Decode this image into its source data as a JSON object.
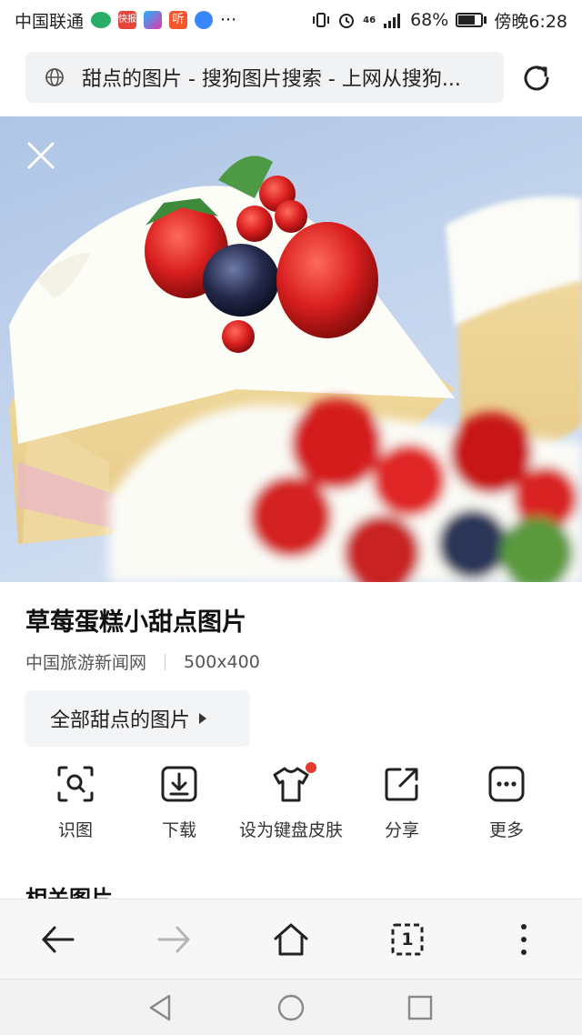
{
  "status_bar": {
    "carrier": "中国联通",
    "app_badge_kuaibao": "快报",
    "app_badge_ting": "听",
    "more": "···",
    "network": "46",
    "battery_percent": "68%",
    "battery_level": 0.68,
    "time": "傍晚6:28"
  },
  "address_bar": {
    "url_title": "甜点的图片 - 搜狗图片搜索 - 上网从搜狗..."
  },
  "image": {
    "title": "草莓蛋糕小甜点图片",
    "source": "中国旅游新闻网",
    "dimensions": "500x400",
    "all_link": "全部甜点的图片"
  },
  "actions": [
    {
      "label": "识图",
      "icon": "image-search-icon"
    },
    {
      "label": "下载",
      "icon": "download-icon"
    },
    {
      "label": "设为键盘皮肤",
      "icon": "tshirt-icon"
    },
    {
      "label": "分享",
      "icon": "share-icon"
    },
    {
      "label": "更多",
      "icon": "more-icon"
    }
  ],
  "related_heading": "相关图片",
  "browser_nav": {
    "tabs_count": "1"
  },
  "colors": {
    "accent_dot": "#e53a2d",
    "page_background": "#ffffff",
    "url_box": "#f1f2f4"
  }
}
